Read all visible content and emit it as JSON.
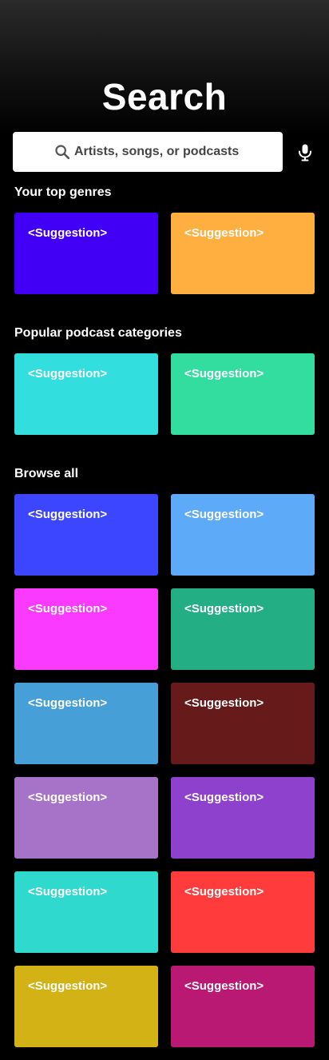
{
  "header": {
    "title": "Search"
  },
  "search": {
    "placeholder": "Artists, songs, or podcasts",
    "icon": "search-icon",
    "mic_icon": "microphone-icon"
  },
  "sections": {
    "top_genres": {
      "heading": "Your top genres",
      "cards": [
        {
          "label": "<Suggestion>",
          "color": "#4100F5"
        },
        {
          "label": "<Suggestion>",
          "color": "#FFAF3F"
        }
      ]
    },
    "podcast_categories": {
      "heading": "Popular podcast categories",
      "cards": [
        {
          "label": "<Suggestion>",
          "color": "#33DFDE"
        },
        {
          "label": "<Suggestion>",
          "color": "#33DDA0"
        }
      ]
    },
    "browse_all": {
      "heading": "Browse all",
      "cards": [
        {
          "label": "<Suggestion>",
          "color": "#3C46FF"
        },
        {
          "label": "<Suggestion>",
          "color": "#5DAAF8"
        },
        {
          "label": "<Suggestion>",
          "color": "#FA3AFE"
        },
        {
          "label": "<Suggestion>",
          "color": "#23AE83"
        },
        {
          "label": "<Suggestion>",
          "color": "#479FD8"
        },
        {
          "label": "<Suggestion>",
          "color": "#661A1A"
        },
        {
          "label": "<Suggestion>",
          "color": "#A673C9"
        },
        {
          "label": "<Suggestion>",
          "color": "#8D41CC"
        },
        {
          "label": "<Suggestion>",
          "color": "#30D9CE"
        },
        {
          "label": "<Suggestion>",
          "color": "#FF3B3B"
        },
        {
          "label": "<Suggestion>",
          "color": "#D2B215"
        },
        {
          "label": "<Suggestion>",
          "color": "#BA1973"
        }
      ]
    }
  }
}
